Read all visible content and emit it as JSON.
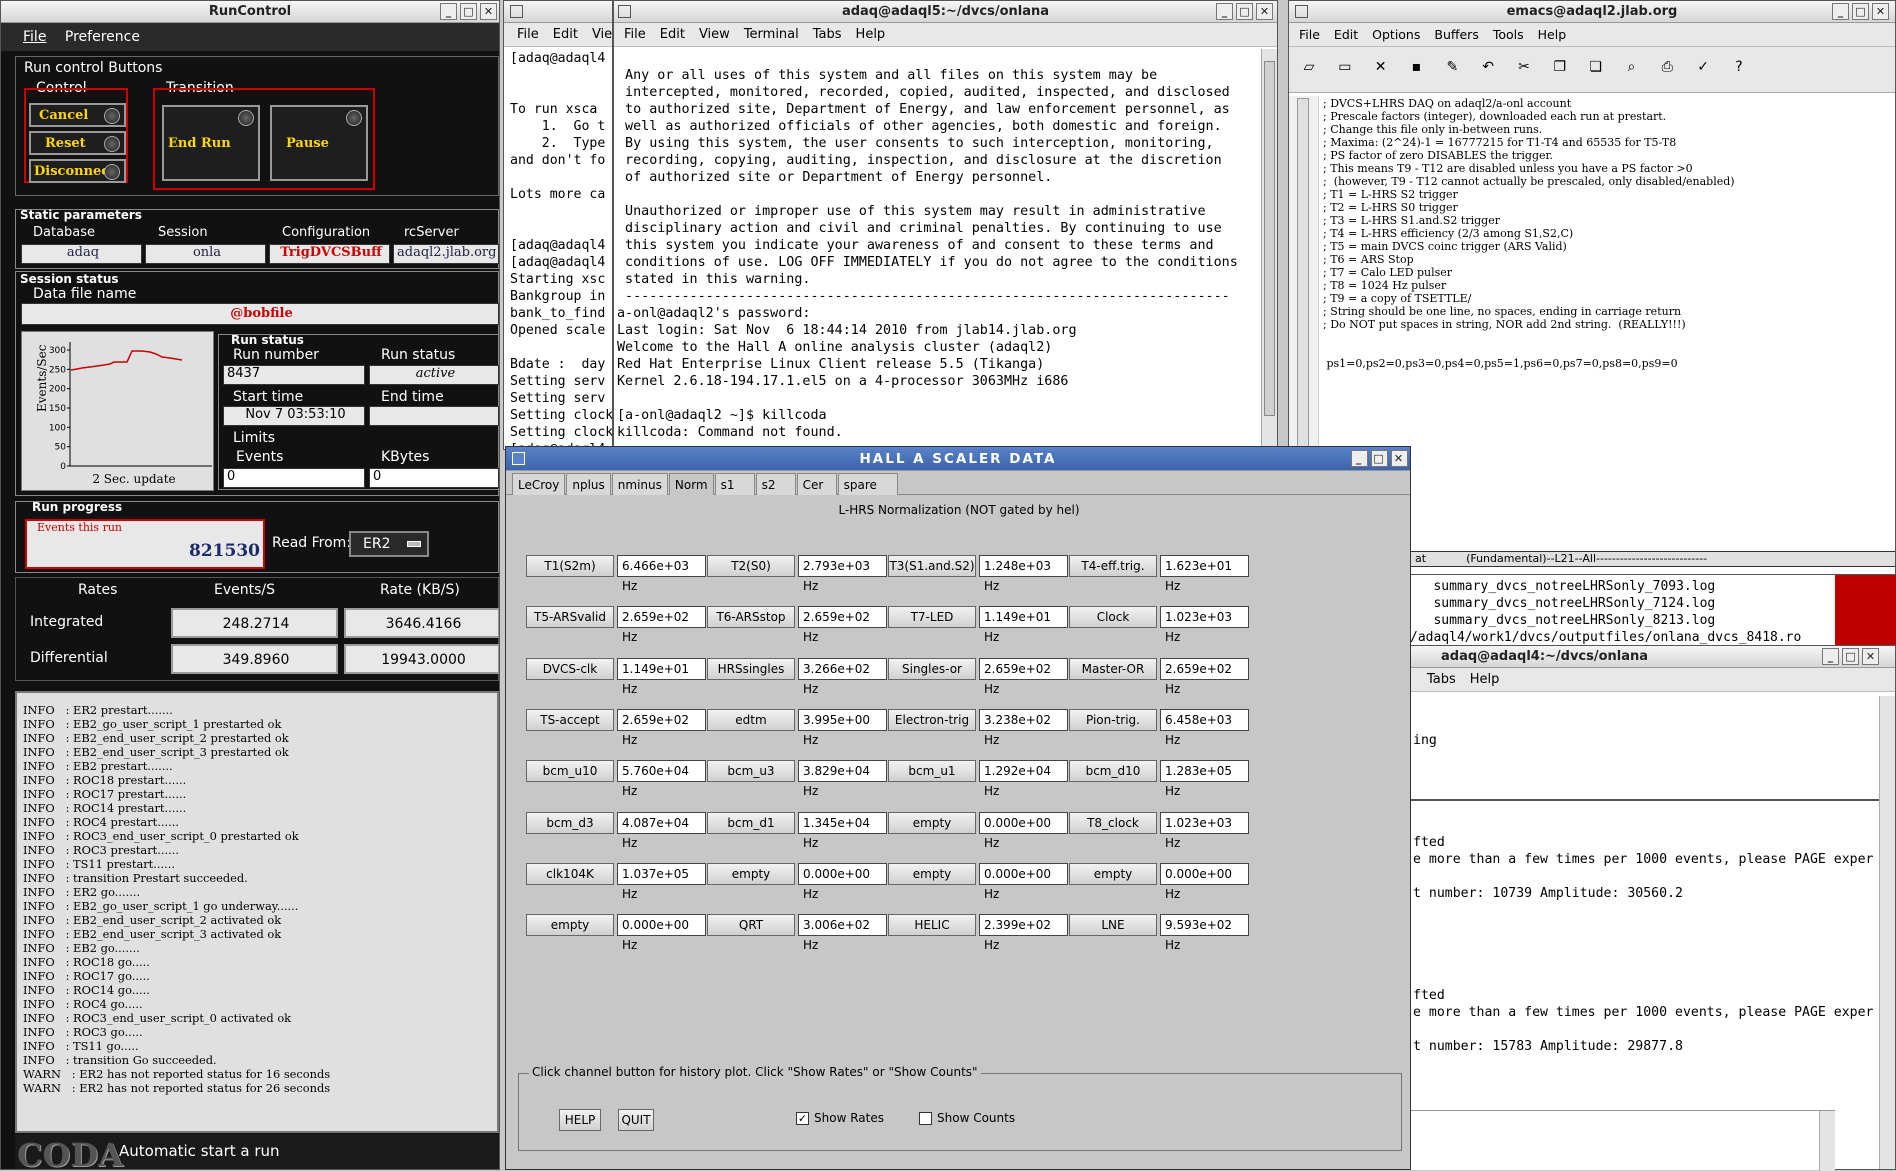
{
  "runcontrol": {
    "title": "RunControl",
    "menu": [
      "File",
      "Preference"
    ],
    "buttons_group": "Run control Buttons",
    "control_label": "Control",
    "transition_label": "Transition",
    "cancel": "Cancel",
    "reset": "Reset",
    "disconnect": "Disconnect",
    "end_run": "End Run",
    "pause": "Pause",
    "static_params": "Static parameters",
    "database_label": "Database",
    "session_label": "Session",
    "config_label": "Configuration",
    "rcserver_label": "rcServer",
    "database": "adaq",
    "session": "onla",
    "configuration": "TrigDVCSBuff",
    "rcserver": "adaql2.jlab.org",
    "session_status": "Session status",
    "data_file_label": "Data file name",
    "data_file": "@bobfile",
    "graph_ylabel": "Events/Sec",
    "graph_yticks": [
      "300",
      "250",
      "200",
      "150",
      "100",
      "50",
      "0"
    ],
    "graph_update": "2 Sec. update",
    "run_status_group": "Run status",
    "run_number_label": "Run number",
    "run_number": "8437",
    "run_status_label": "Run status",
    "run_status": "active",
    "start_time_label": "Start time",
    "start_time": "Nov 7 03:53:10",
    "end_time_label": "End time",
    "end_time": "",
    "limits_label": "Limits",
    "events_label": "Events",
    "kbytes_label": "KBytes",
    "events_limit": "0",
    "kbytes_limit": "0",
    "run_progress": "Run progress",
    "events_this_run_label": "Events this run",
    "events_this_run": "821530",
    "read_from_label": "Read From:",
    "read_from": "ER2",
    "rates_header": [
      "Rates",
      "Events/S",
      "Rate (KB/S)"
    ],
    "integrated_label": "Integrated",
    "integrated_events": "248.2714",
    "integrated_rate": "3646.4166",
    "differential_label": "Differential",
    "differential_events": "349.8960",
    "differential_rate": "19943.0000",
    "log": [
      "INFO   : ER2 prestart.......",
      "INFO   : EB2_go_user_script_1 prestarted ok",
      "INFO   : EB2_end_user_script_2 prestarted ok",
      "INFO   : EB2_end_user_script_3 prestarted ok",
      "INFO   : EB2 prestart.......",
      "INFO   : ROC18 prestart......",
      "INFO   : ROC17 prestart......",
      "INFO   : ROC14 prestart......",
      "INFO   : ROC4 prestart......",
      "INFO   : ROC3_end_user_script_0 prestarted ok",
      "INFO   : ROC3 prestart......",
      "INFO   : TS11 prestart......",
      "INFO   : transition Prestart succeeded.",
      "INFO   : ER2 go.......",
      "INFO   : EB2_go_user_script_1 go underway......",
      "INFO   : EB2_end_user_script_2 activated ok",
      "INFO   : EB2_end_user_script_3 activated ok",
      "INFO   : EB2 go.......",
      "INFO   : ROC18 go.....",
      "INFO   : ROC17 go.....",
      "INFO   : ROC14 go.....",
      "INFO   : ROC4 go.....",
      "INFO   : ROC3_end_user_script_0 activated ok",
      "INFO   : ROC3 go.....",
      "INFO   : TS11 go.....",
      "INFO   : transition Go succeeded.",
      "WARN   : ER2 has not reported status for 16 seconds",
      "WARN   : ER2 has not reported status for 26 seconds"
    ],
    "coda_logo": "CODA",
    "auto_start": "Automatic start a run"
  },
  "term_back": {
    "menu": [
      "File",
      "Edit",
      "Vie"
    ],
    "lines": [
      "[adaq@adaql4",
      "",
      "",
      "To run xsca",
      "    1.  Go t",
      "    2.  Type",
      "and don't fo",
      "",
      "Lots more ca",
      "",
      "",
      "[adaq@adaql4",
      "[adaq@adaql4",
      "Starting xsc",
      "Bankgroup in",
      "bank_to_find",
      "Opened scale",
      "",
      "Bdate :  day",
      "Setting serv",
      "Setting serv",
      "Setting clock",
      "Setting clock",
      "[adaq@adaql4"
    ]
  },
  "term_main": {
    "title": "adaq@adaql5:~/dvcs/onlana",
    "menu": [
      "File",
      "Edit",
      "View",
      "Terminal",
      "Tabs",
      "Help"
    ],
    "lines": [
      "",
      " Any or all uses of this system and all files on this system may be",
      " intercepted, monitored, recorded, copied, audited, inspected, and disclosed",
      " to authorized site, Department of Energy, and law enforcement personnel, as",
      " well as authorized officials of other agencies, both domestic and foreign.",
      " By using this system, the user consents to such interception, monitoring,",
      " recording, copying, auditing, inspection, and disclosure at the discretion",
      " of authorized site or Department of Energy personnel.",
      "",
      " Unauthorized or improper use of this system may result in administrative",
      " disciplinary action and civil and criminal penalties. By continuing to use",
      " this system you indicate your awareness of and consent to these terms and",
      " conditions of use. LOG OFF IMMEDIATELY if you do not agree to the conditions",
      " stated in this warning.",
      " ---------------------------------------------------------------------------",
      "a-onl@adaql2's password:",
      "Last login: Sat Nov  6 18:44:14 2010 from jlab14.jlab.org",
      "Welcome to the Hall A online analysis cluster (adaql2)",
      "Red Hat Enterprise Linux Client release 5.5 (Tikanga)",
      "Kernel 2.6.18-194.17.1.el5 on a 4-processor 3063MHz i686",
      "",
      "[a-onl@adaql2 ~]$ killcoda",
      "killcoda: Command not found."
    ]
  },
  "emacs": {
    "title": "emacs@adaql2.jlab.org",
    "menu": [
      "File",
      "Edit",
      "Options",
      "Buffers",
      "Tools",
      "Help"
    ],
    "toolbar_icons": [
      "new-file-icon",
      "open-folder-icon",
      "close-icon",
      "save-icon",
      "save-as-icon",
      "undo-icon",
      "cut-icon",
      "copy-icon",
      "paste-icon",
      "search-icon",
      "print-icon",
      "preferences-icon",
      "help-icon"
    ],
    "lines": [
      "; DVCS+LHRS DAQ on adaql2/a-onl account",
      "; Prescale factors (integer), downloaded each run at prestart.",
      "; Change this file only in-between runs.",
      "; Maxima: (2^24)-1 = 16777215 for T1-T4 and 65535 for T5-T8",
      "; PS factor of zero DISABLES the trigger.",
      "; This means T9 - T12 are disabled unless you have a PS factor >0",
      ";  (however, T9 - T12 cannot actually be prescaled, only disabled/enabled)",
      "; T1 = L-HRS S2 trigger",
      "; T2 = L-HRS S0 trigger",
      "; T3 = L-HRS S1.and.S2 trigger",
      "; T4 = L-HRS efficiency (2/3 among S1,S2,C)",
      "; T5 = main DVCS coinc trigger (ARS Valid)",
      "; T6 = ARS Stop",
      "; T7 = Calo LED pulser",
      "; T8 = 1024 Hz pulser",
      "; T9 = a copy of TSETTLE/",
      "; String should be one line, no spaces, ending in carriage return",
      "; Do NOT put spaces in string, NOR add 2nd string.  (REALLY!!!)",
      "",
      "",
      " ps1=0,ps2=0,ps3=0,ps4=0,ps5=1,ps6=0,ps7=0,ps8=0,ps9=0"
    ],
    "modeline_left": "at",
    "modeline": "(Fundamental)--L21--All----------------------------"
  },
  "filelist": {
    "lines": [
      "   summary_dvcs_notreeLHRSonly_7093.log",
      "   summary_dvcs_notreeLHRSonly_7124.log",
      "   summary_dvcs_notreeLHRSonly_8213.log",
      "/adaql4/work1/dvcs/outputfiles/onlana_dvcs_8418.ro"
    ]
  },
  "term_right": {
    "title": "adaq@adaql4:~/dvcs/onlana",
    "menu": [
      "Tabs",
      "Help"
    ],
    "lines": [
      "",
      "",
      "ing",
      "",
      "",
      "",
      "",
      "",
      "fted",
      "e more than a few times per 1000 events, please PAGE exper",
      "",
      "t number: 10739 Amplitude: 30560.2",
      "",
      "",
      "",
      "",
      "",
      "fted",
      "e more than a few times per 1000 events, please PAGE exper",
      "",
      "t number: 15783 Amplitude: 29877.8"
    ]
  },
  "scaler": {
    "title": "HALL A SCALER DATA",
    "tabs": [
      "LeCroy",
      "nplus",
      "nminus",
      "Norm",
      "s1",
      "s2",
      "Cer",
      "spare"
    ],
    "active_tab": "Norm",
    "heading": "L-HRS Normalization (NOT gated by hel)",
    "rows": [
      [
        [
          "T1(S2m)",
          "6.466e+03 Hz"
        ],
        [
          "T2(S0)",
          "2.793e+03 Hz"
        ],
        [
          "T3(S1.and.S2)",
          "1.248e+03 Hz"
        ],
        [
          "T4-eff.trig.",
          "1.623e+01 Hz"
        ]
      ],
      [
        [
          "T5-ARSvalid",
          "2.659e+02 Hz"
        ],
        [
          "T6-ARSstop",
          "2.659e+02 Hz"
        ],
        [
          "T7-LED",
          "1.149e+01 Hz"
        ],
        [
          "Clock",
          "1.023e+03 Hz"
        ]
      ],
      [
        [
          "DVCS-clk",
          "1.149e+01 Hz"
        ],
        [
          "HRSsingles",
          "3.266e+02 Hz"
        ],
        [
          "Singles-or",
          "2.659e+02 Hz"
        ],
        [
          "Master-OR",
          "2.659e+02 Hz"
        ]
      ],
      [
        [
          "TS-accept",
          "2.659e+02 Hz"
        ],
        [
          "edtm",
          "3.995e+00 Hz"
        ],
        [
          "Electron-trig",
          "3.238e+02 Hz"
        ],
        [
          "Pion-trig.",
          "6.458e+03 Hz"
        ]
      ],
      [
        [
          "bcm_u10",
          "5.760e+04 Hz"
        ],
        [
          "bcm_u3",
          "3.829e+04 Hz"
        ],
        [
          "bcm_u1",
          "1.292e+04 Hz"
        ],
        [
          "bcm_d10",
          "1.283e+05 Hz"
        ]
      ],
      [
        [
          "bcm_d3",
          "4.087e+04 Hz"
        ],
        [
          "bcm_d1",
          "1.345e+04 Hz"
        ],
        [
          "empty",
          "0.000e+00 Hz"
        ],
        [
          "T8_clock",
          "1.023e+03 Hz"
        ]
      ],
      [
        [
          "clk104K",
          "1.037e+05 Hz"
        ],
        [
          "empty",
          "0.000e+00 Hz"
        ],
        [
          "empty",
          "0.000e+00 Hz"
        ],
        [
          "empty",
          "0.000e+00 Hz"
        ]
      ],
      [
        [
          "empty",
          "0.000e+00 Hz"
        ],
        [
          "QRT",
          "3.006e+02 Hz"
        ],
        [
          "HELIC",
          "2.399e+02 Hz"
        ],
        [
          "LNE",
          "9.593e+02 Hz"
        ]
      ]
    ],
    "footer_label": "Click channel button for history plot.  Click \"Show Rates\" or \"Show Counts\"",
    "help": "HELP",
    "quit": "QUIT",
    "show_rates": "Show Rates",
    "show_counts": "Show Counts"
  },
  "colors": {
    "accent_red": "#cc0000",
    "desktop_red": "#c00000",
    "coda_yellow": "#ffd700"
  }
}
